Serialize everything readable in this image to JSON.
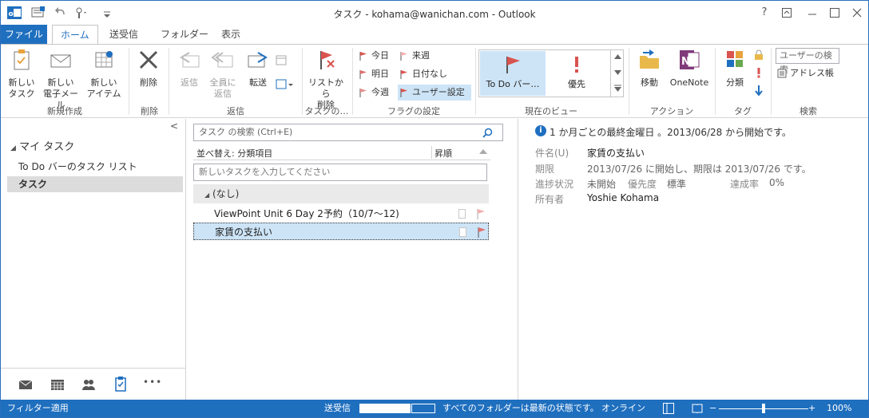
{
  "window": {
    "title": "タスク - kohama@wanichan.com - Outlook",
    "help_label": "?",
    "accent": "#1f6fbf"
  },
  "tabs": [
    {
      "label": "ファイル"
    },
    {
      "label": "ホーム"
    },
    {
      "label": "送受信"
    },
    {
      "label": "フォルダー"
    },
    {
      "label": "表示"
    }
  ],
  "ribbon": {
    "new_task": "新しい\nタスク",
    "new_task_l1": "新しい",
    "new_task_l2": "タスク",
    "new_mail_l1": "新しい",
    "new_mail_l2": "電子メール",
    "new_item_l1": "新しい",
    "new_item_l2": "アイテム",
    "group_new": "新規作成",
    "delete": "削除",
    "group_delete": "削除",
    "reply": "返信",
    "reply_all_l1": "全員に",
    "reply_all_l2": "返信",
    "forward": "転送",
    "group_respond": "返信",
    "remove_l1": "リストから",
    "remove_l2": "削除",
    "group_task": "タスクの…",
    "flag_today": "今日",
    "flag_tomorrow": "明日",
    "flag_thisweek": "今週",
    "flag_nextweek": "来週",
    "flag_nodate": "日付なし",
    "flag_custom": "ユーザー設定",
    "group_flags": "フラグの設定",
    "view_todo": "To Do バー…",
    "view_priority": "優先",
    "group_view": "現在のビュー",
    "move": "移動",
    "onenote": "OneNote",
    "group_actions": "アクション",
    "categorize": "分類",
    "group_tags": "タグ",
    "search_people": "ユーザーの検索",
    "address_book": "アドレス帳",
    "group_find": "検索"
  },
  "leftpane": {
    "header": "マイ タスク",
    "items": [
      {
        "label": "To Do バーのタスク リスト"
      },
      {
        "label": "タスク"
      }
    ],
    "collapse": "<",
    "nav_more": "•••"
  },
  "tasklist": {
    "search_placeholder": "タスク の検索 (Ctrl+E)",
    "sort_label": "並べ替え: 分類項目",
    "sort_order": "昇順",
    "new_task_placeholder": "新しいタスクを入力してください",
    "group_label": "(なし)",
    "rows": [
      {
        "subject": "ViewPoint Unit 6 Day 2予約（10/7～12)"
      },
      {
        "subject": "家賃の支払い"
      }
    ]
  },
  "detail": {
    "info": "1 か月ごとの最終金曜日 。2013/06/28 から開始です。",
    "subject_label": "件名(U)",
    "subject": "家賃の支払い",
    "due_label": "期限",
    "due": "2013/07/26 に開始し、期限は 2013/07/26 です。",
    "status_label": "進捗状況",
    "status": "未開始",
    "priority_label": "優先度",
    "priority": "標準",
    "complete_label": "達成率",
    "complete": "0%",
    "owner_label": "所有者",
    "owner": "Yoshie Kohama"
  },
  "statusbar": {
    "filter": "フィルター適用",
    "sendrecv": "送受信",
    "folders": "すべてのフォルダーは最新の状態です。",
    "online": "オンライン",
    "zoom": "100%",
    "zoom_minus": "−",
    "zoom_plus": "+"
  }
}
